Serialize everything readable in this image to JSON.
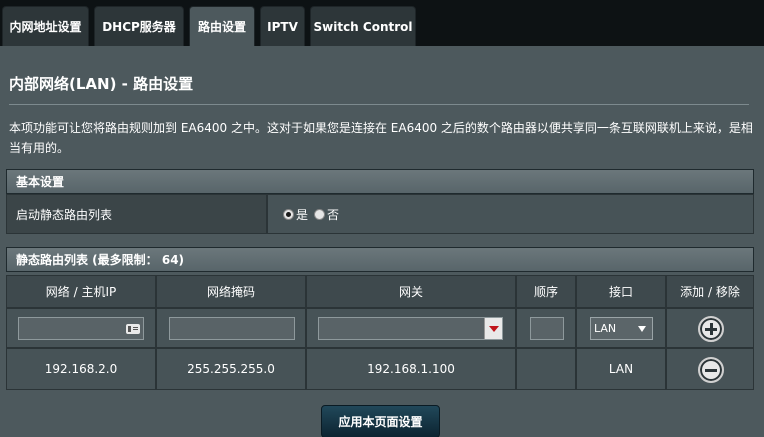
{
  "tabs": [
    {
      "label": "内网地址设置",
      "active": false
    },
    {
      "label": "DHCP服务器",
      "active": false
    },
    {
      "label": "路由设置",
      "active": true
    },
    {
      "label": "IPTV",
      "active": false
    },
    {
      "label": "Switch Control",
      "active": false
    }
  ],
  "page": {
    "title": "内部网络(LAN) - 路由设置",
    "description": "本项功能可让您将路由规则加到 EA6400 之中。这对于如果您是连接在 EA6400 之后的数个路由器以便共享同一条互联网联机上来说，是相当有用的。"
  },
  "basic": {
    "header": "基本设置",
    "enable_label": "启动静态路由列表",
    "options": [
      {
        "label": "是",
        "checked": true
      },
      {
        "label": "否",
        "checked": false
      }
    ]
  },
  "routes": {
    "header": "静态路由列表 (最多限制： 64)",
    "columns": [
      "网络 / 主机IP",
      "网络掩码",
      "网关",
      "顺序",
      "接口",
      "添加 / 移除"
    ],
    "new_entry": {
      "ip": "",
      "mask": "",
      "gateway": "",
      "metric": "",
      "interface": "LAN"
    },
    "rows": [
      {
        "ip": "192.168.2.0",
        "mask": "255.255.255.0",
        "gateway": "192.168.1.100",
        "metric": "",
        "interface": "LAN"
      }
    ],
    "add_icon": "plus-circle-icon",
    "remove_icon": "minus-circle-icon"
  },
  "apply_label": "应用本页面设置"
}
